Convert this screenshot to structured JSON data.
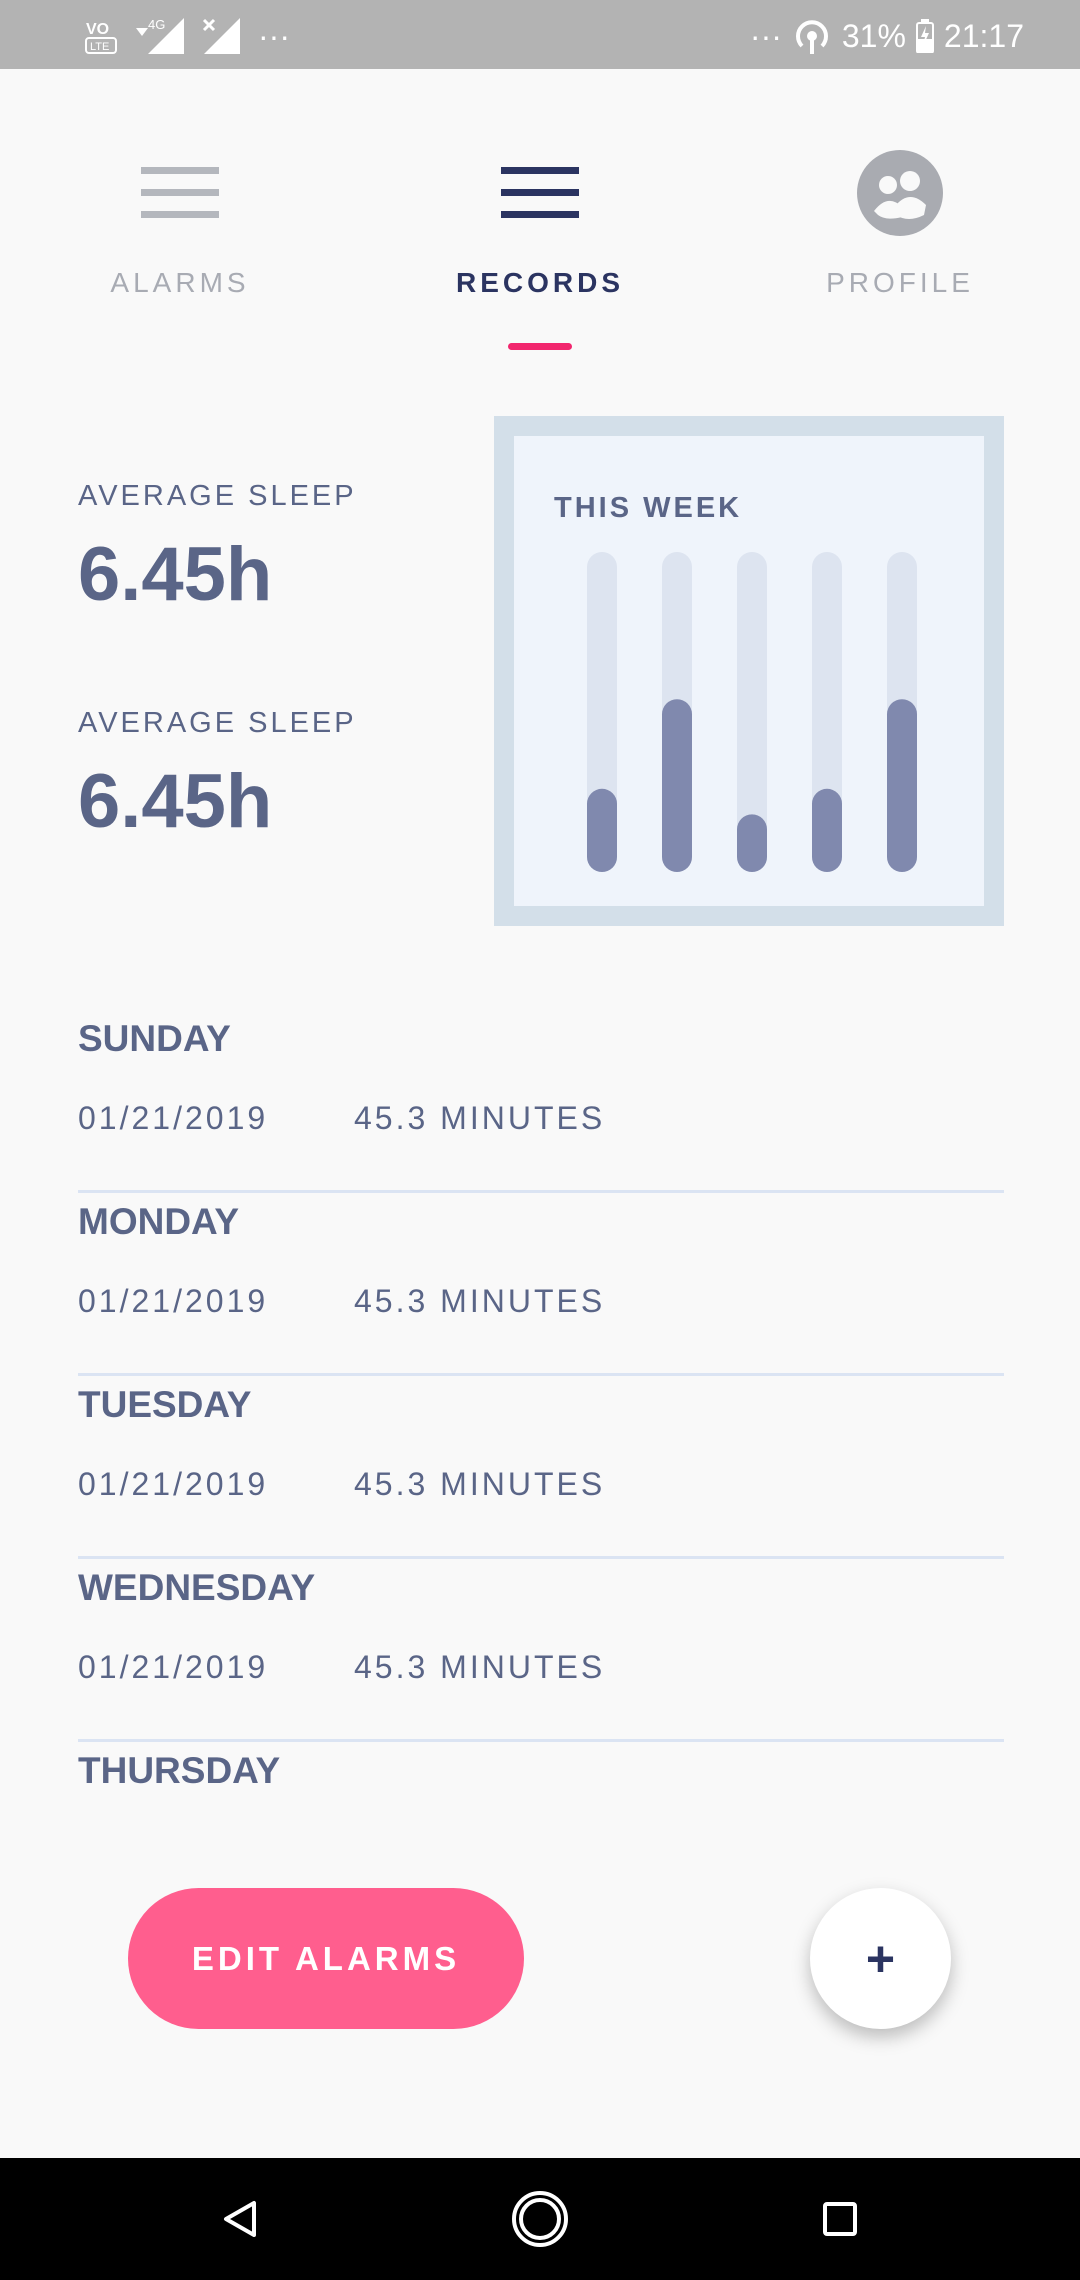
{
  "status_bar": {
    "left_icons": [
      "volte-icon",
      "signal-4g-icon",
      "signal-x-icon",
      "more-notifications-icon"
    ],
    "dots": "···",
    "battery_percent": "31%",
    "time": "21:17"
  },
  "tabs": [
    {
      "label": "ALARMS",
      "icon": "menu-lines-icon",
      "active": false
    },
    {
      "label": "RECORDS",
      "icon": "menu-lines-icon",
      "active": true
    },
    {
      "label": "PROFILE",
      "icon": "profile-avatar-icon",
      "active": false
    }
  ],
  "stats": [
    {
      "label": "AVERAGE SLEEP",
      "value": "6.45h"
    },
    {
      "label": "AVERAGE SLEEP",
      "value": "6.45h"
    }
  ],
  "chart_data": {
    "type": "bar",
    "title": "THIS WEEK",
    "values": [
      0.26,
      0.54,
      0.18,
      0.26,
      0.54
    ],
    "ylim": [
      0,
      1
    ],
    "track_color": "#dde4f0",
    "bar_color": "#8089ae"
  },
  "days": [
    {
      "name": "SUNDAY",
      "date": "01/21/2019",
      "minutes": "45.3 MINUTES"
    },
    {
      "name": "MONDAY",
      "date": "01/21/2019",
      "minutes": "45.3 MINUTES"
    },
    {
      "name": "TUESDAY",
      "date": "01/21/2019",
      "minutes": "45.3 MINUTES"
    },
    {
      "name": "WEDNESDAY",
      "date": "01/21/2019",
      "minutes": "45.3 MINUTES"
    },
    {
      "name": "THURSDAY",
      "date": "",
      "minutes": ""
    }
  ],
  "actions": {
    "edit_label": "EDIT ALARMS",
    "fab_label": "+"
  },
  "colors": {
    "accent": "#f2266e",
    "button": "#ff5e8e",
    "primary_text": "#5a6587",
    "active_tab": "#2b3461"
  }
}
